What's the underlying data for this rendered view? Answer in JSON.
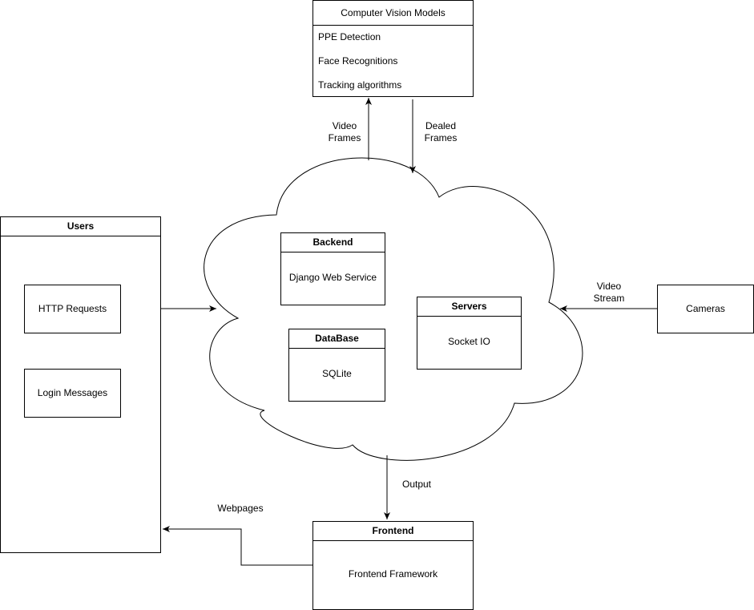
{
  "cv_models": {
    "title": "Computer Vision Models",
    "items": [
      "PPE Detection",
      "Face Recognitions",
      "Tracking algorithms"
    ]
  },
  "users": {
    "title": "Users",
    "http_requests": "HTTP Requests",
    "login_messages": "Login Messages"
  },
  "backend": {
    "title": "Backend",
    "content": "Django Web Service"
  },
  "database": {
    "title": "DataBase",
    "content": "SQLite"
  },
  "servers": {
    "title": "Servers",
    "content": "Socket IO"
  },
  "cameras": {
    "label": "Cameras"
  },
  "frontend": {
    "title": "Frontend",
    "content": "Frontend Framework"
  },
  "edges": {
    "video_frames": [
      "Video",
      "Frames"
    ],
    "dealed_frames": [
      "Dealed",
      "Frames"
    ],
    "video_stream": [
      "Video",
      "Stream"
    ],
    "output": "Output",
    "webpages": "Webpages"
  }
}
